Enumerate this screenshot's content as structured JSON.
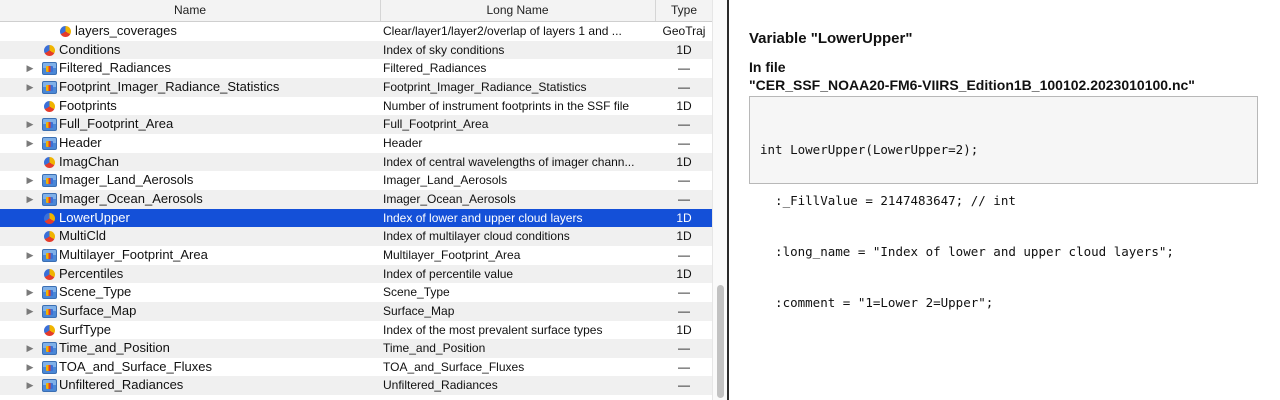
{
  "table": {
    "headers": {
      "name": "Name",
      "long_name": "Long Name",
      "type": "Type"
    },
    "rows": [
      {
        "name": "layers_coverages",
        "long": "Clear/layer1/layer2/overlap of layers 1 and ...",
        "type": "GeoTraj",
        "kind": "variable",
        "depth": 1,
        "expandable": false,
        "selected": false
      },
      {
        "name": "Conditions",
        "long": "Index of sky conditions",
        "type": "1D",
        "kind": "variable",
        "depth": 0,
        "expandable": false,
        "selected": false
      },
      {
        "name": "Filtered_Radiances",
        "long": "Filtered_Radiances",
        "type": "—",
        "kind": "group",
        "depth": 0,
        "expandable": true,
        "selected": false
      },
      {
        "name": "Footprint_Imager_Radiance_Statistics",
        "long": "Footprint_Imager_Radiance_Statistics",
        "type": "—",
        "kind": "group",
        "depth": 0,
        "expandable": true,
        "selected": false
      },
      {
        "name": "Footprints",
        "long": "Number of instrument footprints in the SSF file",
        "type": "1D",
        "kind": "variable",
        "depth": 0,
        "expandable": false,
        "selected": false
      },
      {
        "name": "Full_Footprint_Area",
        "long": "Full_Footprint_Area",
        "type": "—",
        "kind": "group",
        "depth": 0,
        "expandable": true,
        "selected": false
      },
      {
        "name": "Header",
        "long": "Header",
        "type": "—",
        "kind": "group",
        "depth": 0,
        "expandable": true,
        "selected": false
      },
      {
        "name": "ImagChan",
        "long": "Index of central wavelengths of imager chann...",
        "type": "1D",
        "kind": "variable",
        "depth": 0,
        "expandable": false,
        "selected": false
      },
      {
        "name": "Imager_Land_Aerosols",
        "long": "Imager_Land_Aerosols",
        "type": "—",
        "kind": "group",
        "depth": 0,
        "expandable": true,
        "selected": false
      },
      {
        "name": "Imager_Ocean_Aerosols",
        "long": "Imager_Ocean_Aerosols",
        "type": "—",
        "kind": "group",
        "depth": 0,
        "expandable": true,
        "selected": false
      },
      {
        "name": "LowerUpper",
        "long": "Index of lower and upper cloud layers",
        "type": "1D",
        "kind": "variable",
        "depth": 0,
        "expandable": false,
        "selected": true
      },
      {
        "name": "MultiCld",
        "long": "Index of multilayer cloud conditions",
        "type": "1D",
        "kind": "variable",
        "depth": 0,
        "expandable": false,
        "selected": false
      },
      {
        "name": "Multilayer_Footprint_Area",
        "long": "Multilayer_Footprint_Area",
        "type": "—",
        "kind": "group",
        "depth": 0,
        "expandable": true,
        "selected": false
      },
      {
        "name": "Percentiles",
        "long": "Index of percentile value",
        "type": "1D",
        "kind": "variable",
        "depth": 0,
        "expandable": false,
        "selected": false
      },
      {
        "name": "Scene_Type",
        "long": "Scene_Type",
        "type": "—",
        "kind": "group",
        "depth": 0,
        "expandable": true,
        "selected": false
      },
      {
        "name": "Surface_Map",
        "long": "Surface_Map",
        "type": "—",
        "kind": "group",
        "depth": 0,
        "expandable": true,
        "selected": false
      },
      {
        "name": "SurfType",
        "long": "Index of the most prevalent surface types",
        "type": "1D",
        "kind": "variable",
        "depth": 0,
        "expandable": false,
        "selected": false
      },
      {
        "name": "Time_and_Position",
        "long": "Time_and_Position",
        "type": "—",
        "kind": "group",
        "depth": 0,
        "expandable": true,
        "selected": false
      },
      {
        "name": "TOA_and_Surface_Fluxes",
        "long": "TOA_and_Surface_Fluxes",
        "type": "—",
        "kind": "group",
        "depth": 0,
        "expandable": true,
        "selected": false
      },
      {
        "name": "Unfiltered_Radiances",
        "long": "Unfiltered_Radiances",
        "type": "—",
        "kind": "group",
        "depth": 0,
        "expandable": true,
        "selected": false
      }
    ]
  },
  "detail": {
    "title": "Variable \"LowerUpper\"",
    "in_file_label": "In file",
    "file_name": "\"CER_SSF_NOAA20-FM6-VIIRS_Edition1B_100102.2023010100.nc\"",
    "code_lines": [
      "int LowerUpper(LowerUpper=2);",
      "  :_FillValue = 2147483647; // int",
      "  :long_name = \"Index of lower and upper cloud layers\";",
      "  :comment = \"1=Lower 2=Upper\";"
    ]
  },
  "colors": {
    "selection": "#1450d8",
    "alt_row": "#f0f0f0",
    "header_bg": "#f3f3f3"
  }
}
